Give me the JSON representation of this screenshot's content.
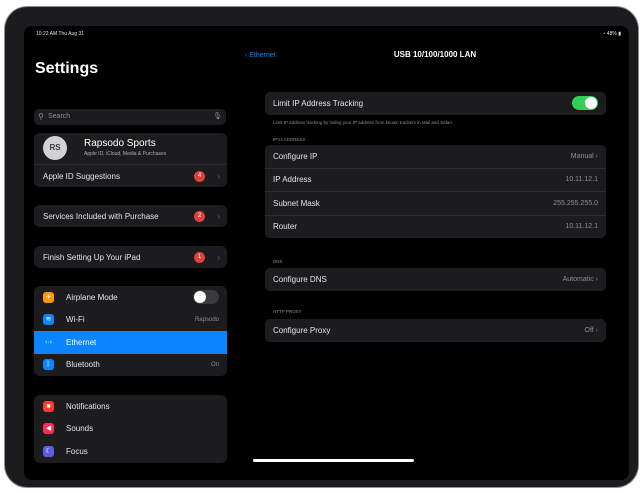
{
  "status_bar": {
    "time": "10:22 AM  Thu Aug 31",
    "battery": "48%"
  },
  "sidebar": {
    "title": "Settings",
    "search_placeholder": "Search",
    "account": {
      "initials": "RS",
      "name": "Rapsodo Sports",
      "subtitle": "Apple ID, iCloud, Media & Purchases"
    },
    "alerts": [
      {
        "label": "Apple ID Suggestions",
        "badge": "4"
      },
      {
        "label": "Services Included with Purchase",
        "badge": "2"
      },
      {
        "label": "Finish Setting Up Your iPad",
        "badge": "1"
      }
    ],
    "connectivity": [
      {
        "label": "Airplane Mode",
        "icon": "airplane-icon",
        "color": "#ff9500"
      },
      {
        "label": "Wi-Fi",
        "value": "Rapsodo",
        "icon": "wifi-icon",
        "color": "#0a84ff"
      },
      {
        "label": "Ethernet",
        "icon": "ethernet-icon",
        "color": "#0a84ff"
      },
      {
        "label": "Bluetooth",
        "value": "On",
        "icon": "bluetooth-icon",
        "color": "#0a84ff"
      }
    ],
    "notify": [
      {
        "label": "Notifications",
        "icon": "notifications-icon",
        "color": "#ff3b30"
      },
      {
        "label": "Sounds",
        "icon": "sounds-icon",
        "color": "#ff2d55"
      },
      {
        "label": "Focus",
        "icon": "focus-icon",
        "color": "#5e5ce6"
      }
    ]
  },
  "detail": {
    "back_label": "Ethernet",
    "title": "USB 10/100/1000 LAN",
    "limit_tracking": {
      "label": "Limit IP Address Tracking",
      "on": true
    },
    "limit_note": "Limit IP address tracking by hiding your IP address from known trackers in Mail and Safari.",
    "ipv4_header": "IPV4 ADDRESS",
    "ipv4": [
      {
        "label": "Configure IP",
        "value": "Manual"
      },
      {
        "label": "IP Address",
        "value": "10.11.12.1"
      },
      {
        "label": "Subnet Mask",
        "value": "255.255.255.0"
      },
      {
        "label": "Router",
        "value": "10.11.12.1"
      }
    ],
    "dns_header": "DNS",
    "dns": {
      "label": "Configure DNS",
      "value": "Automatic"
    },
    "proxy_header": "HTTP PROXY",
    "proxy": {
      "label": "Configure Proxy",
      "value": "Off"
    }
  },
  "colors": {
    "accent": "#0a84ff",
    "toggle_on": "#30d158",
    "badge": "#e0403c"
  }
}
